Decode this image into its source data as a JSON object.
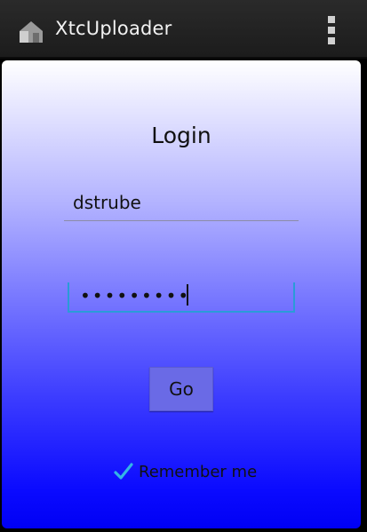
{
  "action_bar": {
    "title": "XtcUploader",
    "app_icon": "home-icon",
    "menu_icon": "overflow-menu-icon"
  },
  "login": {
    "heading": "Login",
    "username_value": "dstrube",
    "password_mask": "•••••••••",
    "go_label": "Go",
    "remember_label": "Remember me",
    "remember_checked": true
  },
  "colors": {
    "action_bar_bg": "#222222",
    "gradient_top": "#ffffff",
    "gradient_bottom": "#0000f4",
    "focus_underline": "#2a9bd8",
    "checkmark": "#33b5e5"
  }
}
